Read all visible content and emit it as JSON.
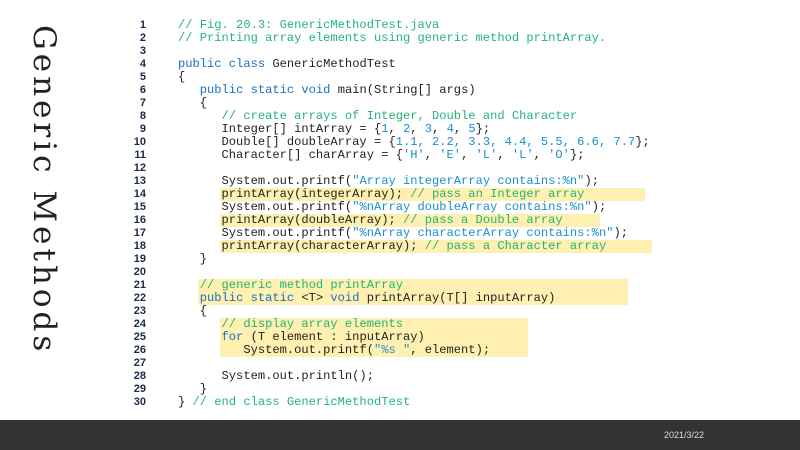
{
  "slide_title": "Generic Methods",
  "footer": {
    "date": "2021/3/22"
  },
  "colors": {
    "keyword": "#1a6fc4",
    "comment": "#22b573",
    "string": "#1a8fd0",
    "highlight": "#fdf0b0",
    "footer_bar": "#333333"
  },
  "code": [
    {
      "n": "1",
      "seg": [
        [
          "cm",
          "// Fig. 20.3: GenericMethodTest.java"
        ]
      ]
    },
    {
      "n": "2",
      "seg": [
        [
          "cm",
          "// Printing array elements using generic method printArray."
        ]
      ]
    },
    {
      "n": "3",
      "seg": []
    },
    {
      "n": "4",
      "seg": [
        [
          "kw",
          "public class "
        ],
        [
          "pl",
          "GenericMethodTest"
        ]
      ]
    },
    {
      "n": "5",
      "seg": [
        [
          "pl",
          "{"
        ]
      ]
    },
    {
      "n": "6",
      "seg": [
        [
          "pl",
          "   "
        ],
        [
          "kw",
          "public static void "
        ],
        [
          "pl",
          "main(String[] args)"
        ]
      ]
    },
    {
      "n": "7",
      "seg": [
        [
          "pl",
          "   {"
        ]
      ]
    },
    {
      "n": "8",
      "seg": [
        [
          "pl",
          "      "
        ],
        [
          "cm",
          "// create arrays of Integer, Double and Character"
        ]
      ]
    },
    {
      "n": "9",
      "seg": [
        [
          "pl",
          "      Integer[] intArray = {"
        ],
        [
          "nu",
          "1"
        ],
        [
          "pl",
          ", "
        ],
        [
          "nu",
          "2"
        ],
        [
          "pl",
          ", "
        ],
        [
          "nu",
          "3"
        ],
        [
          "pl",
          ", "
        ],
        [
          "nu",
          "4"
        ],
        [
          "pl",
          ", "
        ],
        [
          "nu",
          "5"
        ],
        [
          "pl",
          "};"
        ]
      ]
    },
    {
      "n": "10",
      "seg": [
        [
          "pl",
          "      Double[] doubleArray = {"
        ],
        [
          "nu",
          "1.1, 2.2, 3.3, 4.4, 5.5, 6.6, 7.7"
        ],
        [
          "pl",
          "};"
        ]
      ]
    },
    {
      "n": "11",
      "seg": [
        [
          "pl",
          "      Character[] charArray = {"
        ],
        [
          "st",
          "'H'"
        ],
        [
          "pl",
          ", "
        ],
        [
          "st",
          "'E'"
        ],
        [
          "pl",
          ", "
        ],
        [
          "st",
          "'L'"
        ],
        [
          "pl",
          ", "
        ],
        [
          "st",
          "'L'"
        ],
        [
          "pl",
          ", "
        ],
        [
          "st",
          "'O'"
        ],
        [
          "pl",
          "};"
        ]
      ]
    },
    {
      "n": "12",
      "seg": []
    },
    {
      "n": "13",
      "seg": [
        [
          "pl",
          "      System.out.printf("
        ],
        [
          "st",
          "\"Array integerArray contains:%n\""
        ],
        [
          "pl",
          ");"
        ]
      ]
    },
    {
      "n": "14",
      "hl": true,
      "seg": [
        [
          "pl",
          "      printArray(integerArray); "
        ],
        [
          "cm",
          "// pass an Integer array"
        ]
      ]
    },
    {
      "n": "15",
      "seg": [
        [
          "pl",
          "      System.out.printf("
        ],
        [
          "st",
          "\"%nArray doubleArray contains:%n\""
        ],
        [
          "pl",
          ");"
        ]
      ]
    },
    {
      "n": "16",
      "hl": true,
      "seg": [
        [
          "pl",
          "      printArray(doubleArray); "
        ],
        [
          "cm",
          "// pass a Double array"
        ]
      ]
    },
    {
      "n": "17",
      "seg": [
        [
          "pl",
          "      System.out.printf("
        ],
        [
          "st",
          "\"%nArray characterArray contains:%n\""
        ],
        [
          "pl",
          ");"
        ]
      ]
    },
    {
      "n": "18",
      "hl": true,
      "seg": [
        [
          "pl",
          "      printArray(characterArray); "
        ],
        [
          "cm",
          "// pass a Character array"
        ]
      ]
    },
    {
      "n": "19",
      "seg": [
        [
          "pl",
          "   }"
        ]
      ]
    },
    {
      "n": "20",
      "seg": []
    },
    {
      "n": "21",
      "hl": true,
      "seg": [
        [
          "pl",
          "   "
        ],
        [
          "cm",
          "// generic method printArray"
        ]
      ]
    },
    {
      "n": "22",
      "hl": true,
      "seg": [
        [
          "pl",
          "   "
        ],
        [
          "kw",
          "public static "
        ],
        [
          "pl",
          "<T> "
        ],
        [
          "kw",
          "void "
        ],
        [
          "pl",
          "printArray(T[] inputArray)"
        ]
      ]
    },
    {
      "n": "23",
      "seg": [
        [
          "pl",
          "   {"
        ]
      ]
    },
    {
      "n": "24",
      "hl": true,
      "seg": [
        [
          "pl",
          "      "
        ],
        [
          "cm",
          "// display array elements"
        ]
      ]
    },
    {
      "n": "25",
      "hl": true,
      "seg": [
        [
          "pl",
          "      "
        ],
        [
          "kw",
          "for "
        ],
        [
          "pl",
          "(T element : inputArray)"
        ]
      ]
    },
    {
      "n": "26",
      "hl": true,
      "seg": [
        [
          "pl",
          "         System.out.printf("
        ],
        [
          "st",
          "\"%s \""
        ],
        [
          "pl",
          ", element);"
        ]
      ]
    },
    {
      "n": "27",
      "seg": []
    },
    {
      "n": "28",
      "seg": [
        [
          "pl",
          "      System.out.println();"
        ]
      ]
    },
    {
      "n": "29",
      "seg": [
        [
          "pl",
          "   }"
        ]
      ]
    },
    {
      "n": "30",
      "seg": [
        [
          "pl",
          "} "
        ],
        [
          "cm",
          "// end class GenericMethodTest"
        ]
      ]
    }
  ]
}
